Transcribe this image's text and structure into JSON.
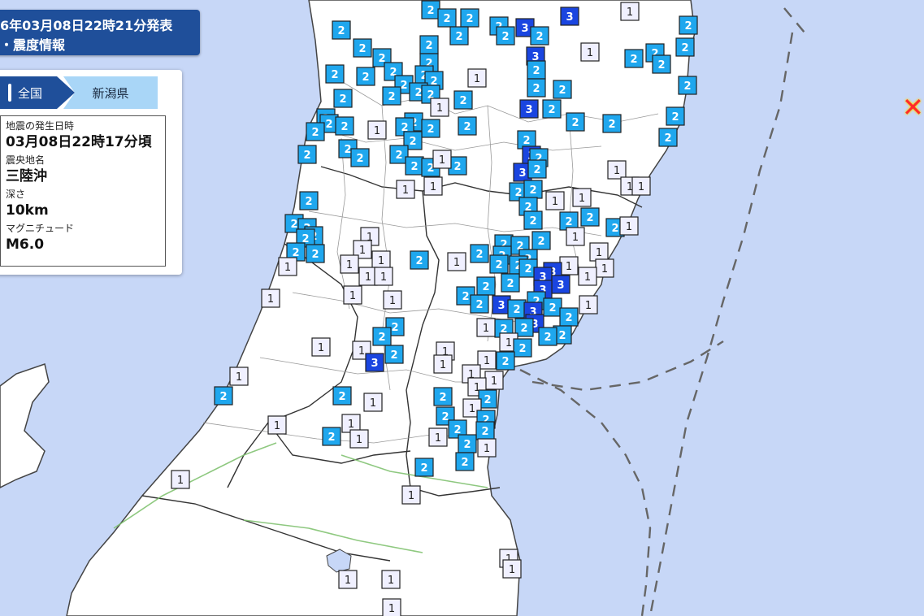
{
  "header": {
    "line1": "6年03月08日22時21分発表",
    "line2": "・震度情報"
  },
  "tabs": {
    "all": "全国",
    "pref": "新潟県"
  },
  "quake": {
    "time_label": "地震の発生日時",
    "time_value": "03月08日22時17分頃",
    "epi_label": "震央地名",
    "epi_value": "三陸沖",
    "depth_label": "深さ",
    "depth_value": "10km",
    "mag_label": "マグニチュード",
    "mag_value": "M6.0"
  },
  "colors": {
    "sea": "#c7d7f7",
    "land": "#ffffff",
    "int1": "#f0f0ff",
    "int2": "#1fa7ee",
    "int3": "#1a45e0",
    "header": "#1f4f9a",
    "tab_pref": "#a9d6f7",
    "epicenter": "#ff2b2b"
  },
  "icons": {
    "epicenter": "epicenter-x-icon"
  },
  "markers": [
    [
      1,
      775,
      14
    ],
    [
      2,
      530,
      12
    ],
    [
      2,
      550,
      22
    ],
    [
      3,
      701,
      20
    ],
    [
      2,
      578,
      22
    ],
    [
      2,
      614,
      32
    ],
    [
      2,
      622,
      44
    ],
    [
      3,
      646,
      34
    ],
    [
      2,
      664,
      44
    ],
    [
      2,
      847,
      31
    ],
    [
      2,
      420,
      37
    ],
    [
      2,
      446,
      59
    ],
    [
      2,
      528,
      55
    ],
    [
      2,
      565,
      44
    ],
    [
      1,
      726,
      64
    ],
    [
      2,
      780,
      72
    ],
    [
      2,
      806,
      65
    ],
    [
      2,
      814,
      79
    ],
    [
      2,
      843,
      58
    ],
    [
      3,
      659,
      69
    ],
    [
      2,
      470,
      71
    ],
    [
      2,
      528,
      77
    ],
    [
      2,
      412,
      91
    ],
    [
      2,
      450,
      94
    ],
    [
      2,
      484,
      88
    ],
    [
      2,
      522,
      92
    ],
    [
      2,
      534,
      99
    ],
    [
      2,
      660,
      86
    ],
    [
      1,
      587,
      96
    ],
    [
      2,
      497,
      104
    ],
    [
      2,
      515,
      113
    ],
    [
      2,
      530,
      116
    ],
    [
      2,
      660,
      108
    ],
    [
      2,
      692,
      110
    ],
    [
      2,
      846,
      105
    ],
    [
      2,
      422,
      121
    ],
    [
      2,
      482,
      118
    ],
    [
      2,
      570,
      123
    ],
    [
      1,
      541,
      132
    ],
    [
      2,
      831,
      143
    ],
    [
      2,
      679,
      134
    ],
    [
      3,
      651,
      134
    ],
    [
      2,
      401,
      145
    ],
    [
      2,
      405,
      152
    ],
    [
      2,
      424,
      155
    ],
    [
      2,
      509,
      150
    ],
    [
      2,
      530,
      158
    ],
    [
      2,
      575,
      155
    ],
    [
      2,
      708,
      150
    ],
    [
      2,
      753,
      152
    ],
    [
      1,
      464,
      160
    ],
    [
      2,
      498,
      156
    ],
    [
      2,
      508,
      173
    ],
    [
      2,
      822,
      169
    ],
    [
      2,
      648,
      172
    ],
    [
      2,
      388,
      162
    ],
    [
      2,
      378,
      190
    ],
    [
      2,
      428,
      183
    ],
    [
      2,
      443,
      194
    ],
    [
      3,
      654,
      191
    ],
    [
      2,
      663,
      194
    ],
    [
      2,
      491,
      190
    ],
    [
      2,
      510,
      204
    ],
    [
      2,
      530,
      206
    ],
    [
      2,
      563,
      204
    ],
    [
      1,
      544,
      196
    ],
    [
      1,
      759,
      209
    ],
    [
      3,
      643,
      212
    ],
    [
      2,
      661,
      208
    ],
    [
      1,
      775,
      229
    ],
    [
      1,
      789,
      229
    ],
    [
      1,
      499,
      233
    ],
    [
      1,
      533,
      229
    ],
    [
      2,
      638,
      236
    ],
    [
      2,
      656,
      233
    ],
    [
      2,
      650,
      254
    ],
    [
      2,
      380,
      247
    ],
    [
      1,
      683,
      247
    ],
    [
      1,
      716,
      243
    ],
    [
      2,
      656,
      271
    ],
    [
      2,
      700,
      272
    ],
    [
      2,
      726,
      267
    ],
    [
      2,
      757,
      280
    ],
    [
      1,
      774,
      278
    ],
    [
      2,
      362,
      275
    ],
    [
      2,
      378,
      280
    ],
    [
      2,
      386,
      290
    ],
    [
      2,
      376,
      293
    ],
    [
      2,
      364,
      310
    ],
    [
      2,
      388,
      312
    ],
    [
      1,
      455,
      291
    ],
    [
      1,
      446,
      307
    ],
    [
      1,
      708,
      291
    ],
    [
      2,
      666,
      296
    ],
    [
      2,
      620,
      300
    ],
    [
      2,
      640,
      302
    ],
    [
      2,
      590,
      312
    ],
    [
      2,
      618,
      314
    ],
    [
      2,
      650,
      318
    ],
    [
      1,
      737,
      310
    ],
    [
      1,
      430,
      325
    ],
    [
      1,
      469,
      320
    ],
    [
      1,
      453,
      340
    ],
    [
      1,
      354,
      328
    ],
    [
      1,
      562,
      322
    ],
    [
      2,
      516,
      320
    ],
    [
      1,
      744,
      330
    ],
    [
      1,
      700,
      327
    ],
    [
      1,
      723,
      340
    ],
    [
      2,
      614,
      325
    ],
    [
      2,
      638,
      326
    ],
    [
      2,
      650,
      330
    ],
    [
      3,
      680,
      334
    ],
    [
      3,
      668,
      340
    ],
    [
      2,
      628,
      348
    ],
    [
      2,
      598,
      352
    ],
    [
      3,
      690,
      350
    ],
    [
      3,
      668,
      356
    ],
    [
      2,
      660,
      370
    ],
    [
      1,
      472,
      340
    ],
    [
      1,
      333,
      367
    ],
    [
      1,
      434,
      363
    ],
    [
      1,
      483,
      369
    ],
    [
      2,
      573,
      364
    ],
    [
      2,
      590,
      374
    ],
    [
      3,
      617,
      375
    ],
    [
      2,
      636,
      380
    ],
    [
      2,
      680,
      378
    ],
    [
      1,
      724,
      375
    ],
    [
      3,
      656,
      383
    ],
    [
      2,
      700,
      390
    ],
    [
      3,
      658,
      398
    ],
    [
      2,
      620,
      404
    ],
    [
      2,
      645,
      403
    ],
    [
      1,
      598,
      403
    ],
    [
      2,
      692,
      412
    ],
    [
      2,
      674,
      414
    ],
    [
      2,
      486,
      402
    ],
    [
      2,
      470,
      414
    ],
    [
      1,
      395,
      427
    ],
    [
      1,
      445,
      431
    ],
    [
      1,
      626,
      421
    ],
    [
      1,
      548,
      432
    ],
    [
      2,
      643,
      428
    ],
    [
      2,
      485,
      436
    ],
    [
      3,
      461,
      446
    ],
    [
      2,
      622,
      444
    ],
    [
      1,
      545,
      448
    ],
    [
      1,
      599,
      443
    ],
    [
      1,
      294,
      463
    ],
    [
      1,
      580,
      460
    ],
    [
      1,
      608,
      468
    ],
    [
      1,
      587,
      476
    ],
    [
      2,
      275,
      487
    ],
    [
      2,
      421,
      487
    ],
    [
      1,
      459,
      495
    ],
    [
      2,
      545,
      488
    ],
    [
      2,
      600,
      491
    ],
    [
      1,
      581,
      502
    ],
    [
      2,
      548,
      512
    ],
    [
      2,
      598,
      516
    ],
    [
      2,
      563,
      528
    ],
    [
      1,
      341,
      523
    ],
    [
      1,
      432,
      521
    ],
    [
      2,
      597,
      530
    ],
    [
      2,
      408,
      537
    ],
    [
      1,
      442,
      540
    ],
    [
      1,
      539,
      538
    ],
    [
      2,
      575,
      546
    ],
    [
      1,
      599,
      551
    ],
    [
      2,
      572,
      568
    ],
    [
      2,
      522,
      575
    ],
    [
      1,
      222,
      590
    ],
    [
      1,
      506,
      609
    ],
    [
      1,
      626,
      687
    ],
    [
      1,
      630,
      700
    ],
    [
      1,
      428,
      713
    ],
    [
      1,
      481,
      713
    ],
    [
      1,
      482,
      748
    ]
  ]
}
